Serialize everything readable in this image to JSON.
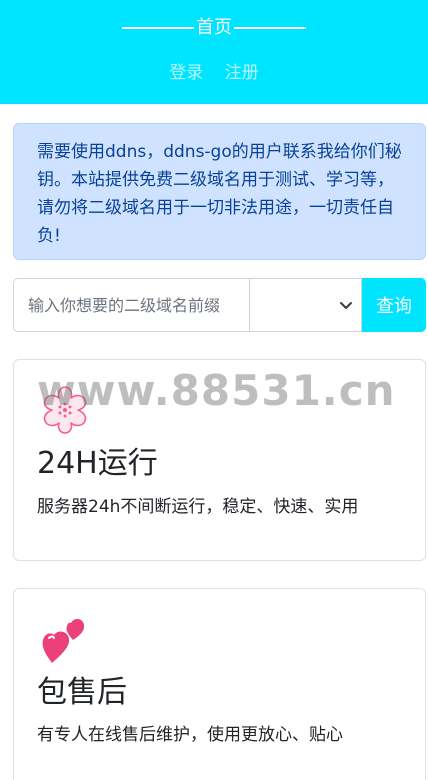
{
  "header": {
    "title": "首页",
    "nav": [
      {
        "label": "登录"
      },
      {
        "label": "注册"
      }
    ]
  },
  "notice": {
    "text": "需要使用ddns，ddns-go的用户联系我给你们秘钥。本站提供免费二级域名用于测试、学习等，请勿将二级域名用于一切非法用途，一切责任自负!"
  },
  "search": {
    "placeholder": "输入你想要的二级域名前缀",
    "select_value": "",
    "button_label": "查询"
  },
  "features": [
    {
      "icon": "cherry-blossom-icon",
      "title": "24H运行",
      "text": "服务器24h不间断运行，稳定、快速、实用"
    },
    {
      "icon": "two-hearts-icon",
      "title": "包售后",
      "text": "有专人在线售后维护，使用更放心、贴心"
    }
  ],
  "watermark": "www.88531.cn",
  "colors": {
    "accent": "#00e5ff",
    "alert_bg": "#cfe2ff",
    "alert_text": "#084298"
  }
}
